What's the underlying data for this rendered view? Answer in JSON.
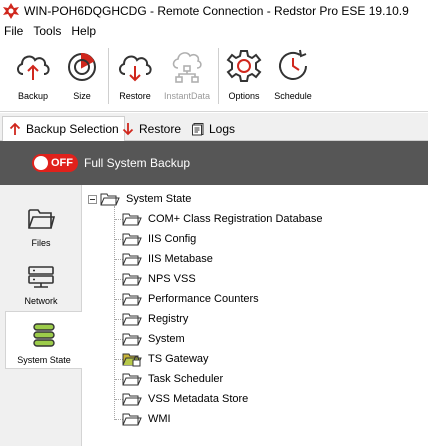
{
  "window": {
    "title": "WIN-POH6DQGHCDG - Remote Connection - Redstor Pro ESE 19.10.9"
  },
  "menu": {
    "items": [
      "File",
      "Tools",
      "Help"
    ]
  },
  "ribbon": {
    "buttons": [
      {
        "label": "Backup",
        "icon": "cloud-upload-icon",
        "enabled": true
      },
      {
        "label": "Size",
        "icon": "size-gauge-icon",
        "enabled": true
      },
      {
        "label": "Restore",
        "icon": "cloud-download-icon",
        "enabled": true
      },
      {
        "label": "InstantData",
        "icon": "instantdata-icon",
        "enabled": false
      },
      {
        "label": "Options",
        "icon": "gear-icon",
        "enabled": true
      },
      {
        "label": "Schedule",
        "icon": "clock-icon",
        "enabled": true
      }
    ]
  },
  "tabs": [
    {
      "label": "Backup Selection",
      "icon": "arrow-up-icon",
      "active": true
    },
    {
      "label": "Restore",
      "icon": "arrow-down-icon",
      "active": false
    },
    {
      "label": "Logs",
      "icon": "logs-icon",
      "active": false
    }
  ],
  "banner": {
    "toggle_state": "OFF",
    "title": "Full System Backup"
  },
  "sidebar": {
    "items": [
      {
        "label": "Files",
        "icon": "folder-icon",
        "active": false
      },
      {
        "label": "Network",
        "icon": "network-icon",
        "active": false
      },
      {
        "label": "System State",
        "icon": "system-state-icon",
        "active": true
      }
    ]
  },
  "tree": {
    "root": {
      "label": "System State",
      "expanded": true
    },
    "children": [
      {
        "label": "COM+ Class Registration Database",
        "locked": false
      },
      {
        "label": "IIS Config",
        "locked": false
      },
      {
        "label": "IIS Metabase",
        "locked": false
      },
      {
        "label": "NPS VSS",
        "locked": false
      },
      {
        "label": "Performance Counters",
        "locked": false
      },
      {
        "label": "Registry",
        "locked": false
      },
      {
        "label": "System",
        "locked": false
      },
      {
        "label": "TS Gateway",
        "locked": true
      },
      {
        "label": "Task Scheduler",
        "locked": false
      },
      {
        "label": "VSS Metadata Store",
        "locked": false
      },
      {
        "label": "WMI",
        "locked": false
      }
    ]
  },
  "colors": {
    "accent": "#e0211b",
    "banner_bg": "#565656",
    "icon_stroke": "#333333",
    "locked_folder": "#c9b53a"
  }
}
